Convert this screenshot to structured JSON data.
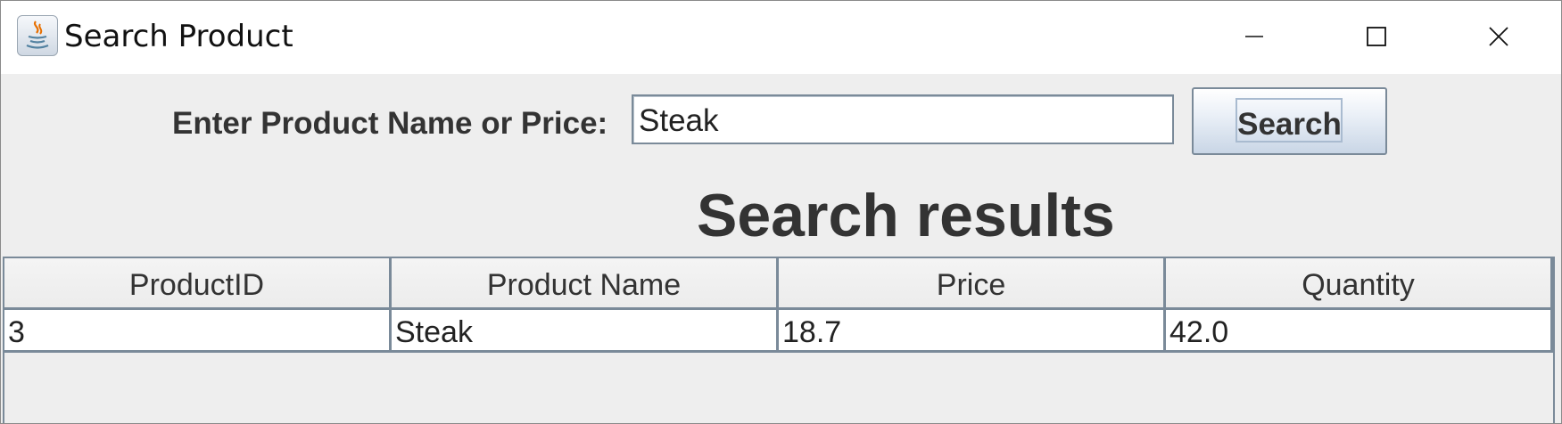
{
  "window": {
    "title": "Search Product",
    "icon": "java-cup-icon",
    "controls": {
      "minimize": "minimize-icon",
      "maximize": "maximize-icon",
      "close": "close-icon"
    }
  },
  "search": {
    "label": "Enter Product Name or Price:",
    "value": "Steak",
    "button_label": "Search"
  },
  "results": {
    "heading": "Search results",
    "columns": [
      "ProductID",
      "Product Name",
      "Price",
      "Quantity"
    ],
    "rows": [
      [
        "3",
        "Steak",
        "18.7",
        "42.0"
      ]
    ]
  },
  "colors": {
    "background": "#eeeeee",
    "border": "#7a8a99",
    "text": "#333333"
  }
}
